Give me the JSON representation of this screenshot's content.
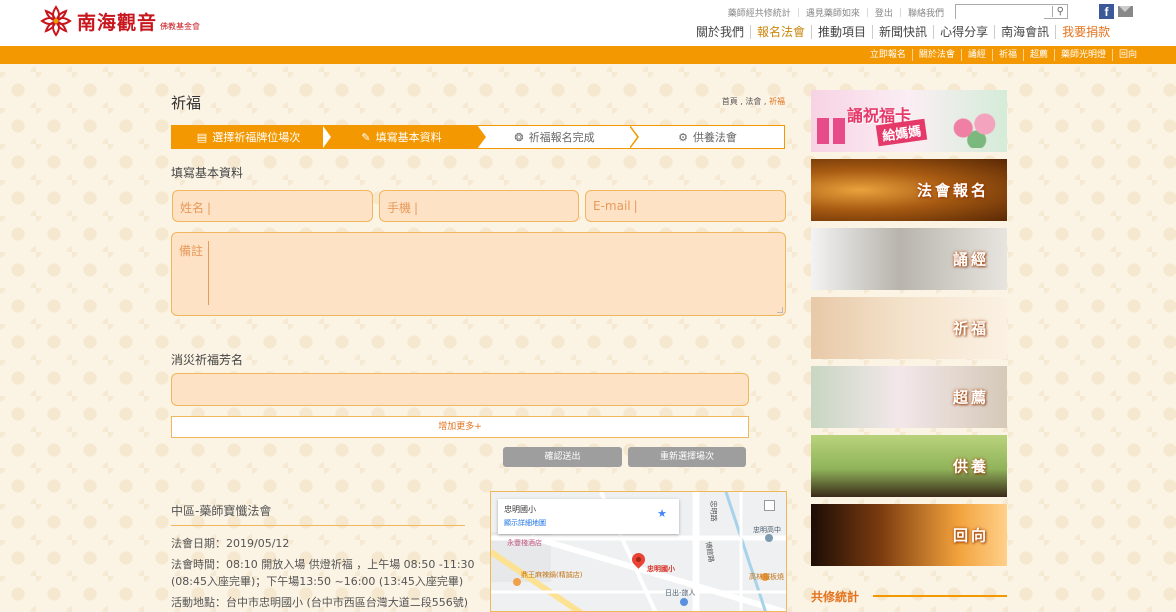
{
  "header": {
    "logo_text": "南海觀音",
    "logo_sub": "佛教基金會",
    "util_links": [
      "藥師經共修統計",
      "遇見藥師如來",
      "登出",
      "聯絡我們"
    ],
    "search_placeholder": "",
    "nav": [
      "關於我們",
      "報名法會",
      "推動項目",
      "新聞快訊",
      "心得分享",
      "南海會訊",
      "我要捐款"
    ],
    "facebook_letter": "f"
  },
  "subnav": [
    "立即報名",
    "關於法會",
    "誦經",
    "祈福",
    "超薦",
    "藥師光明燈",
    "回向"
  ],
  "page": {
    "title": "祈福",
    "breadcrumb": [
      "首頁",
      "法會",
      "祈福"
    ]
  },
  "steps": [
    {
      "label": "選擇祈福牌位場次",
      "icon": "calendar-icon"
    },
    {
      "label": "填寫基本資料",
      "icon": "pencil-icon"
    },
    {
      "label": "祈福報名完成",
      "icon": "film-icon"
    },
    {
      "label": "供養法會",
      "icon": "gear-icon"
    }
  ],
  "form": {
    "section_basic": "填寫基本資料",
    "name_placeholder": "姓名",
    "phone_placeholder": "手機",
    "email_placeholder": "E-mail",
    "note_placeholder": "備註",
    "section_names": "消災祈福芳名",
    "add_more": "增加更多+",
    "submit": "確認送出",
    "reselect": "重新選擇場次"
  },
  "event": {
    "title": "中區-藥師寶懺法會",
    "date": "法會日期：2019/05/12",
    "time_line1": "法會時間：08:10 開放入場 供燈祈福 ，上午場 08:50 -11:30",
    "time_line2": "(08:45入座完畢)；下午場13:50 ~16:00 (13:45入座完畢)",
    "location": "活動地點：台中市忠明國小 (台中市西區台灣大道二段556號)"
  },
  "map": {
    "card_title": "忠明國小",
    "card_link": "顯示詳細地圖",
    "labels": [
      "永豐棧酒店",
      "鼎王麻辣鍋(精誠店)",
      "忠明國小",
      "日出-旅人",
      "高林鐵板燒",
      "忠明高中",
      "博館路",
      "忠明路"
    ]
  },
  "sidebar": {
    "banners": [
      "誦祝福卡 給媽媽",
      "法會報名",
      "誦經",
      "祈福",
      "超薦",
      "供養",
      "回向"
    ],
    "card_line1": "誦祝福卡",
    "card_line2": "給媽媽",
    "section_title": "共修統計"
  },
  "colors": {
    "accent": "#f39800",
    "field_bg": "#fde2c5",
    "brand_red": "#c8161d"
  }
}
